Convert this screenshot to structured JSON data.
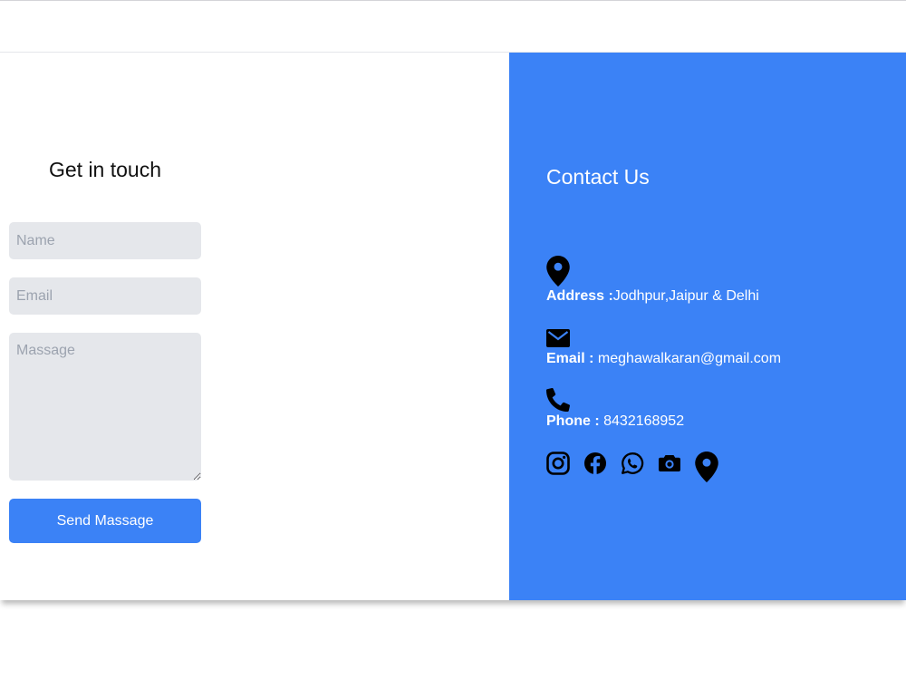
{
  "form": {
    "title": "Get in touch",
    "name_placeholder": "Name",
    "email_placeholder": "Email",
    "message_placeholder": "Massage",
    "send_label": "Send Massage"
  },
  "contact": {
    "title": "Contact Us",
    "address_label": "Address :",
    "address_value": "Jodhpur,Jaipur & Delhi",
    "email_label": "Email :",
    "email_value": " meghawalkaran@gmail.com",
    "phone_label": "Phone :",
    "phone_value": " 8432168952",
    "icons": [
      "map-pin-icon",
      "envelope-icon",
      "phone-icon"
    ],
    "social_icons": [
      "instagram-icon",
      "facebook-icon",
      "whatsapp-icon",
      "camera-icon",
      "map-pin-icon"
    ]
  },
  "colors": {
    "accent": "#3b82f6",
    "field_bg": "#e5e7eb",
    "placeholder": "#9ca3af",
    "icon": "#000000",
    "text_light": "#ffffff"
  }
}
